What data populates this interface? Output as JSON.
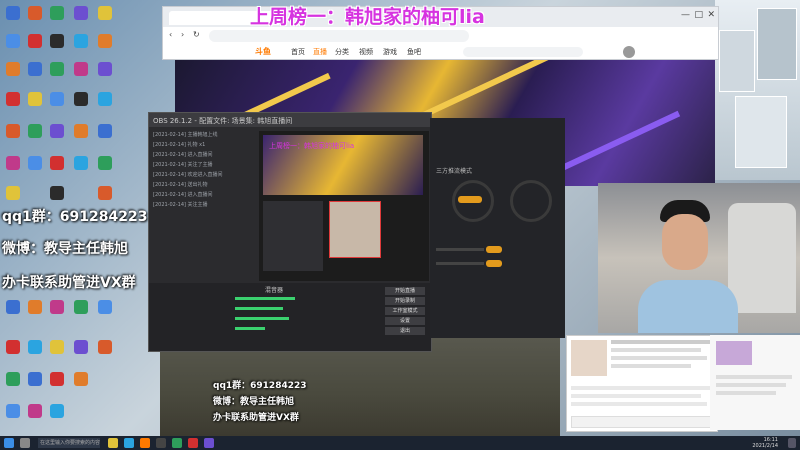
{
  "overlay": {
    "rank_title": "上周榜一：韩旭家的柚可lia",
    "qq_group": "qq1群：691284223",
    "weibo": "微博：教导主任韩旭",
    "contact": "办卡联系助管进VX群",
    "qq_group_small": "qq1群：691284223",
    "weibo_small": "微博：教导主任韩旭",
    "contact_small": "办卡联系助管进VX群"
  },
  "browser": {
    "site_logo": "斗鱼",
    "nav": [
      "首页",
      "直播",
      "分类",
      "视频",
      "游戏",
      "鱼吧"
    ]
  },
  "obs": {
    "title": "OBS 26.1.2 - 配置文件: 场景集: 韩旭直播间",
    "log_lines": [
      "[2021-02-14] 主播韩旭上线",
      "[2021-02-14] 礼物 x1",
      "[2021-02-14] 进入直播间",
      "[2021-02-14] 关注了主播",
      "[2021-02-14] 欢迎进入直播间",
      "[2021-02-14] 送出礼物",
      "[2021-02-14] 进入直播间",
      "[2021-02-14] 关注主播"
    ],
    "mixer_label": "混音器",
    "buttons": [
      "开始直播",
      "开始录制",
      "工作室模式",
      "设置",
      "退出"
    ]
  },
  "darkapp": {
    "label": "三方推流模式"
  },
  "colors": {
    "accent_orange": "#e39b1d",
    "overlay_pink": "#d633e0",
    "obs_bg": "#2b2b2e",
    "meter_green": "#3bd16f"
  },
  "taskbar": {
    "search_label": "在这里输入你要搜索的内容",
    "time": "16:11",
    "date": "2021/2/14"
  }
}
